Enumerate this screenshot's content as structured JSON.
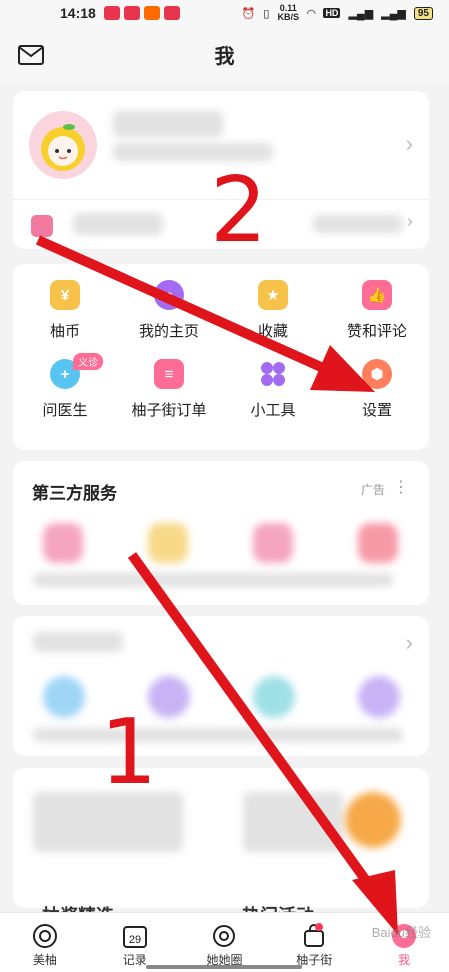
{
  "status_bar": {
    "time": "14:18",
    "net_speed": "0.11\nKB/S",
    "battery": "95"
  },
  "header": {
    "title": "我",
    "mail_icon": "mail-icon"
  },
  "tools": [
    {
      "label": "柚币",
      "icon": "coin-icon",
      "color": "#f7c24a"
    },
    {
      "label": "我的主页",
      "icon": "home-page-icon",
      "color": "#a36bf2"
    },
    {
      "label": "收藏",
      "icon": "star-icon",
      "color": "#f7c24a"
    },
    {
      "label": "赞和评论",
      "icon": "thumb-icon",
      "color": "#ff6d97"
    },
    {
      "label": "问医生",
      "icon": "doctor-icon",
      "color": "#58c4f2",
      "badge": "义诊"
    },
    {
      "label": "柚子街订单",
      "icon": "order-icon",
      "color": "#ff6d97"
    },
    {
      "label": "小工具",
      "icon": "tools-icon",
      "color": "#a36bf2"
    },
    {
      "label": "设置",
      "icon": "settings-icon",
      "color": "#ff7e5c"
    }
  ],
  "services": {
    "title": "第三方服务",
    "ad": "广告"
  },
  "bottom_sections": {
    "left_title": "柚酱精选",
    "right_title": "热门活动"
  },
  "tabs": [
    {
      "label": "美柚",
      "icon": "meiyou-icon",
      "active": false
    },
    {
      "label": "记录",
      "icon": "calendar-icon",
      "day": "29",
      "active": false
    },
    {
      "label": "她她圈",
      "icon": "circle-icon",
      "active": false
    },
    {
      "label": "柚子街",
      "icon": "shop-bag-icon",
      "active": false
    },
    {
      "label": "我",
      "icon": "me-icon",
      "active": true
    }
  ],
  "annotations": {
    "one": "1",
    "two": "2"
  },
  "watermark": "Baidu经验"
}
